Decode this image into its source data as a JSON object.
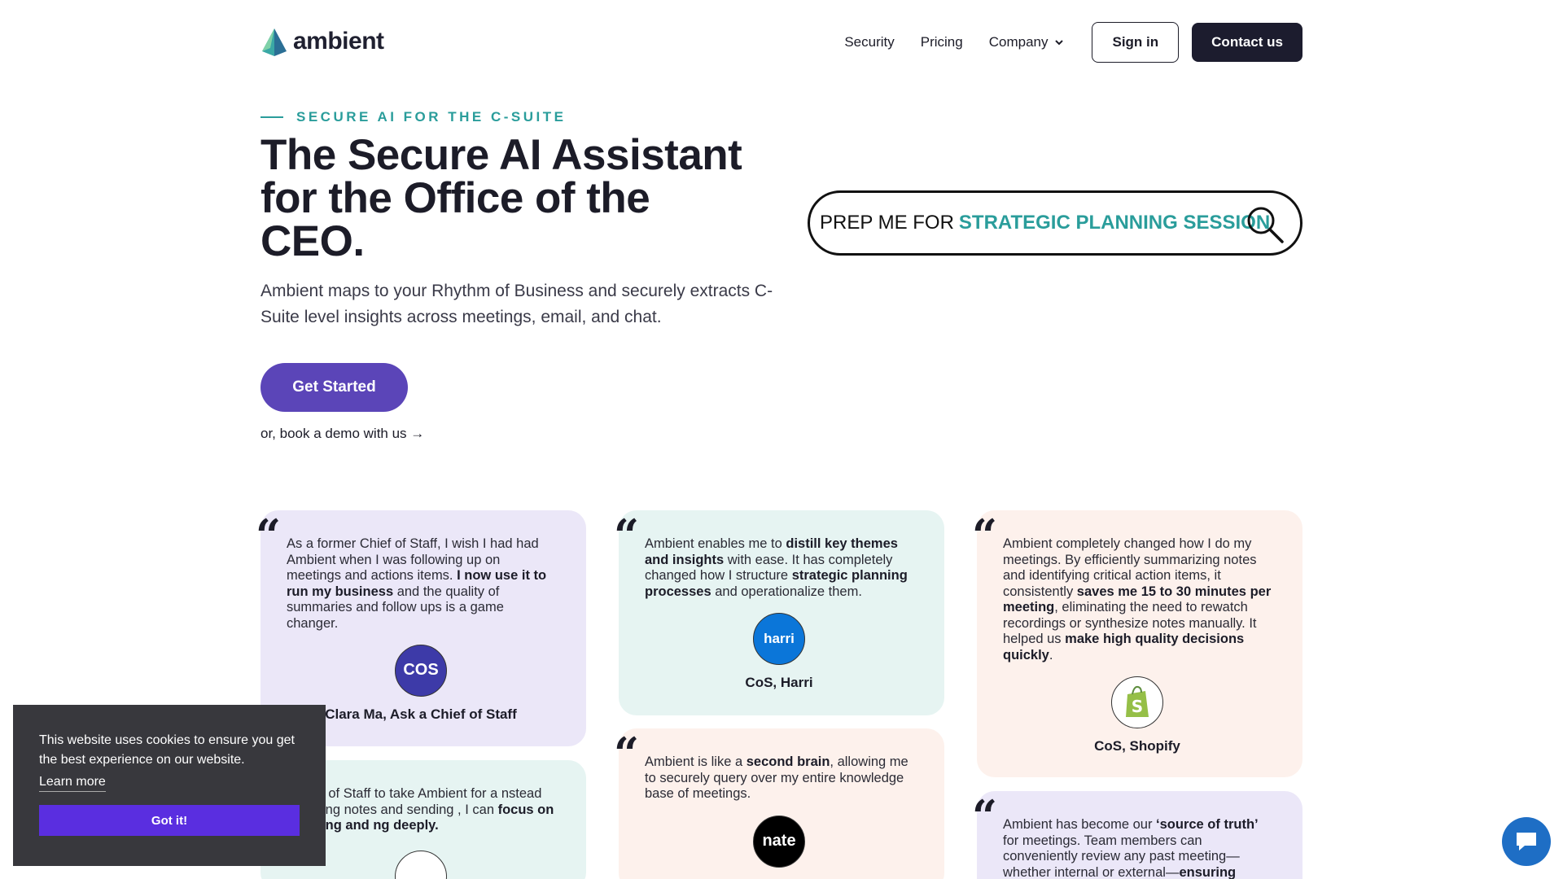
{
  "brand": {
    "name": "ambient"
  },
  "nav": {
    "links": [
      "Security",
      "Pricing",
      "Company"
    ],
    "signin": "Sign in",
    "contact": "Contact us"
  },
  "hero": {
    "eyebrow": "SECURE AI FOR THE C-SUITE",
    "title": "The Secure AI Assistant for the Office of the CEO.",
    "subtitle": "Ambient maps to your Rhythm of Business and securely extracts C-Suite level insights across meetings, email, and chat.",
    "cta": "Get Started",
    "demo": "or, book a demo with us →"
  },
  "search": {
    "prefix": "PREP ME FOR",
    "highlight": "STRATEGIC PLANNING SESSION"
  },
  "testimonials": [
    {
      "parts": [
        {
          "t": "As a former Chief of Staff, I wish I had had Ambient when I was following up on meetings and actions items. ",
          "b": false
        },
        {
          "t": "I now use it to run my business",
          "b": true
        },
        {
          "t": " and the quality of summaries and follow ups is a game changer.",
          "b": false
        }
      ],
      "logo": "COS",
      "author": "Clara Ma, Ask a Chief of Staff"
    },
    {
      "parts": [
        {
          "t": "Ambient enables me to ",
          "b": false
        },
        {
          "t": "distill key themes and insights",
          "b": true
        },
        {
          "t": " with ease. It has completely changed how I structure ",
          "b": false
        },
        {
          "t": "strategic planning processes",
          "b": true
        },
        {
          "t": " and operationalize them.",
          "b": false
        }
      ],
      "logo": "harri",
      "author": "CoS, Harri"
    },
    {
      "parts": [
        {
          "t": "Ambient completely changed how I do my meetings. By efficiently summarizing notes and identifying critical action items, it consistently ",
          "b": false
        },
        {
          "t": "saves me 15 to 30 minutes per meeting",
          "b": true
        },
        {
          "t": ", eliminating the need to rewatch recordings or synthesize notes manually. It helped us ",
          "b": false
        },
        {
          "t": "make high quality decisions quickly",
          "b": true
        },
        {
          "t": ".",
          "b": false
        }
      ],
      "logo": "shopify",
      "author": "CoS, Shopify"
    },
    {
      "parts": [
        {
          "t": "Ambient is like a ",
          "b": false
        },
        {
          "t": "second brain",
          "b": true
        },
        {
          "t": ", allowing me to securely query over my entire knowledge base of meetings.",
          "b": false
        }
      ],
      "logo": "nate",
      "author": ""
    },
    {
      "parts": [
        {
          "t": "Chiefs of Staff to take Ambient for a nstead of writing notes and sending , I can ",
          "b": false
        },
        {
          "t": "focus on listening and ng deeply.",
          "b": true
        }
      ],
      "logo": "",
      "author": ""
    },
    {
      "parts": [
        {
          "t": "Ambient has become our ",
          "b": false
        },
        {
          "t": "‘source of truth’",
          "b": true
        },
        {
          "t": " for meetings. Team members can conveniently review any past meeting—whether internal or external—",
          "b": false
        },
        {
          "t": "ensuring",
          "b": true
        }
      ],
      "logo": "",
      "author": ""
    }
  ],
  "cookie": {
    "text": "This website uses cookies to ensure you get the best experience on our website.",
    "learn": "Learn more",
    "button": "Got it!"
  },
  "quote_glyph": "“",
  "colors": {
    "accent": "#2a9d9b",
    "primary": "#5b45b8",
    "dark": "#1c1c2e"
  }
}
